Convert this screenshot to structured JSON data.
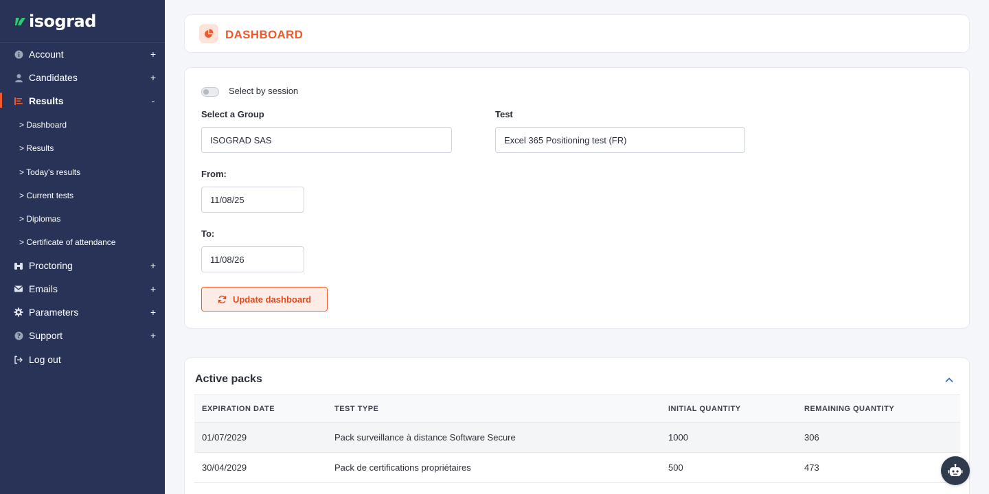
{
  "brand": {
    "name": "isograd"
  },
  "sidebar": {
    "items": [
      {
        "label": "Account",
        "toggle": "+"
      },
      {
        "label": "Candidates",
        "toggle": "+"
      },
      {
        "label": "Results",
        "toggle": "-"
      },
      {
        "label": "Proctoring",
        "toggle": "+"
      },
      {
        "label": "Emails",
        "toggle": "+"
      },
      {
        "label": "Parameters",
        "toggle": "+"
      },
      {
        "label": "Support",
        "toggle": "+"
      },
      {
        "label": "Log out",
        "toggle": ""
      }
    ],
    "results_subitems": [
      "> Dashboard",
      "> Results",
      "> Today's results",
      "> Current tests",
      "> Diplomas",
      "> Certificate of attendance"
    ]
  },
  "header": {
    "title": "DASHBOARD"
  },
  "form": {
    "session_toggle_label": "Select by session",
    "group_label": "Select a Group",
    "group_value": "ISOGRAD SAS",
    "test_label": "Test",
    "test_value": "Excel 365 Positioning test (FR)",
    "from_label": "From:",
    "from_value": "11/08/25",
    "to_label": "To:",
    "to_value": "11/08/26",
    "update_button": "Update dashboard"
  },
  "packs": {
    "title": "Active packs",
    "columns": [
      "EXPIRATION DATE",
      "TEST TYPE",
      "INITIAL QUANTITY",
      "REMAINING QUANTITY"
    ],
    "rows": [
      [
        "01/07/2029",
        "Pack surveillance à distance Software Secure",
        "1000",
        "306"
      ],
      [
        "30/04/2029",
        "Pack de certifications propriétaires",
        "500",
        "473"
      ]
    ]
  },
  "colors": {
    "sidebar_bg": "#283357",
    "accent": "#f1592a",
    "page_bg": "#f4f6f9"
  }
}
